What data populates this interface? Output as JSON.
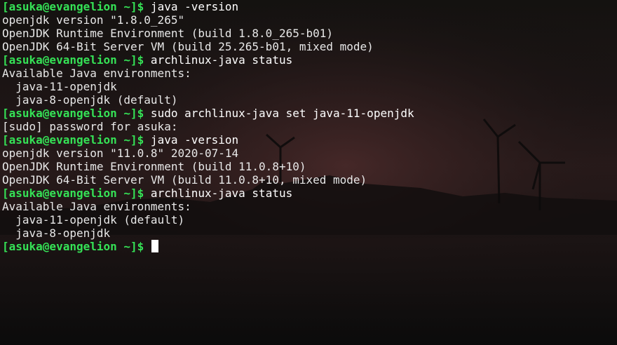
{
  "colors": {
    "prompt": "#35e256",
    "text": "#eaeaea",
    "cursor": "#ffffff",
    "background": "#1a1414"
  },
  "prompt": "[asuka@evangelion ~]$",
  "lines": [
    {
      "type": "prompt",
      "cmd": "java -version"
    },
    {
      "type": "out",
      "text": "openjdk version \"1.8.0_265\""
    },
    {
      "type": "out",
      "text": "OpenJDK Runtime Environment (build 1.8.0_265-b01)"
    },
    {
      "type": "out",
      "text": "OpenJDK 64-Bit Server VM (build 25.265-b01, mixed mode)"
    },
    {
      "type": "prompt",
      "cmd": "archlinux-java status"
    },
    {
      "type": "out",
      "text": "Available Java environments:"
    },
    {
      "type": "out",
      "text": "  java-11-openjdk"
    },
    {
      "type": "out",
      "text": "  java-8-openjdk (default)"
    },
    {
      "type": "prompt",
      "cmd": "sudo archlinux-java set java-11-openjdk"
    },
    {
      "type": "out",
      "text": "[sudo] password for asuka:"
    },
    {
      "type": "prompt",
      "cmd": "java -version"
    },
    {
      "type": "out",
      "text": "openjdk version \"11.0.8\" 2020-07-14"
    },
    {
      "type": "out",
      "text": "OpenJDK Runtime Environment (build 11.0.8+10)"
    },
    {
      "type": "out",
      "text": "OpenJDK 64-Bit Server VM (build 11.0.8+10, mixed mode)"
    },
    {
      "type": "prompt",
      "cmd": "archlinux-java status"
    },
    {
      "type": "out",
      "text": "Available Java environments:"
    },
    {
      "type": "out",
      "text": "  java-11-openjdk (default)"
    },
    {
      "type": "out",
      "text": "  java-8-openjdk"
    },
    {
      "type": "prompt",
      "cmd": "",
      "cursor": true
    }
  ]
}
